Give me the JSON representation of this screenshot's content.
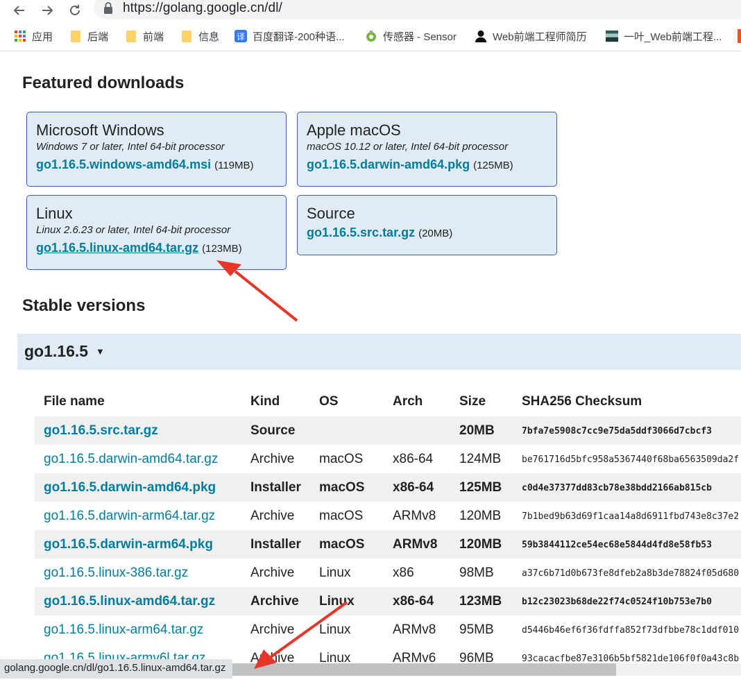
{
  "browser": {
    "url": "https://golang.google.cn/dl/",
    "bookmarks": [
      "应用",
      "后端",
      "前端",
      "信息",
      "百度翻译-200种语...",
      "传感器 - Sensor",
      "Web前端工程师简历",
      "一叶_Web前端工程..."
    ],
    "status_url": "golang.google.cn/dl/go1.16.5.linux-amd64.tar.gz"
  },
  "featured": {
    "title": "Featured downloads",
    "cards": [
      {
        "os": "Microsoft Windows",
        "req": "Windows 7 or later, Intel 64-bit processor",
        "file": "go1.16.5.windows-amd64.msi",
        "size": "(119MB)"
      },
      {
        "os": "Apple macOS",
        "req": "macOS 10.12 or later, Intel 64-bit processor",
        "file": "go1.16.5.darwin-amd64.pkg",
        "size": "(125MB)"
      },
      {
        "os": "Linux",
        "req": "Linux 2.6.23 or later, Intel 64-bit processor",
        "file": "go1.16.5.linux-amd64.tar.gz",
        "size": "(123MB)"
      },
      {
        "os": "Source",
        "req": "",
        "file": "go1.16.5.src.tar.gz",
        "size": "(20MB)"
      }
    ]
  },
  "stable": {
    "title": "Stable versions",
    "version": "go1.16.5",
    "toggle": "▼"
  },
  "table": {
    "headers": {
      "file": "File name",
      "kind": "Kind",
      "os": "OS",
      "arch": "Arch",
      "size": "Size",
      "checksum": "SHA256 Checksum"
    },
    "rows": [
      {
        "file": "go1.16.5.src.tar.gz",
        "kind": "Source",
        "os": "",
        "arch": "",
        "size": "20MB",
        "checksum": "7bfa7e5908c7cc9e75da5ddf3066d7cbcf3",
        "highlight": true
      },
      {
        "file": "go1.16.5.darwin-amd64.tar.gz",
        "kind": "Archive",
        "os": "macOS",
        "arch": "x86-64",
        "size": "124MB",
        "checksum": "be761716d5bfc958a5367440f68ba6563509da2f",
        "highlight": false
      },
      {
        "file": "go1.16.5.darwin-amd64.pkg",
        "kind": "Installer",
        "os": "macOS",
        "arch": "x86-64",
        "size": "125MB",
        "checksum": "c0d4e37377dd83cb78e38bdd2166ab815cb",
        "highlight": true
      },
      {
        "file": "go1.16.5.darwin-arm64.tar.gz",
        "kind": "Archive",
        "os": "macOS",
        "arch": "ARMv8",
        "size": "120MB",
        "checksum": "7b1bed9b63d69f1caa14a8d6911fbd743e8c37e2",
        "highlight": false
      },
      {
        "file": "go1.16.5.darwin-arm64.pkg",
        "kind": "Installer",
        "os": "macOS",
        "arch": "ARMv8",
        "size": "120MB",
        "checksum": "59b3844112ce54ec68e5844d4fd8e58fb53",
        "highlight": true
      },
      {
        "file": "go1.16.5.linux-386.tar.gz",
        "kind": "Archive",
        "os": "Linux",
        "arch": "x86",
        "size": "98MB",
        "checksum": "a37c6b71d0b673fe8dfeb2a8b3de78824f05d680",
        "highlight": false
      },
      {
        "file": "go1.16.5.linux-amd64.tar.gz",
        "kind": "Archive",
        "os": "Linux",
        "arch": "x86-64",
        "size": "123MB",
        "checksum": "b12c23023b68de22f74c0524f10b753e7b0",
        "highlight": true
      },
      {
        "file": "go1.16.5.linux-arm64.tar.gz",
        "kind": "Archive",
        "os": "Linux",
        "arch": "ARMv8",
        "size": "95MB",
        "checksum": "d5446b46ef6f36fdffa852f73dfbbe78c1ddf010",
        "highlight": false
      },
      {
        "file": "go1.16.5.linux-armv6l.tar.gz",
        "kind": "Archive",
        "os": "Linux",
        "arch": "ARMv6",
        "size": "96MB",
        "checksum": "93cacacfbe87e3106b5bf5821de106f0f0a43c8b",
        "highlight": false
      }
    ]
  },
  "colors": {
    "link": "#007d9c",
    "card_bg": "#e0ebf5",
    "card_border": "#375eab",
    "annotation": "#e8352a"
  }
}
